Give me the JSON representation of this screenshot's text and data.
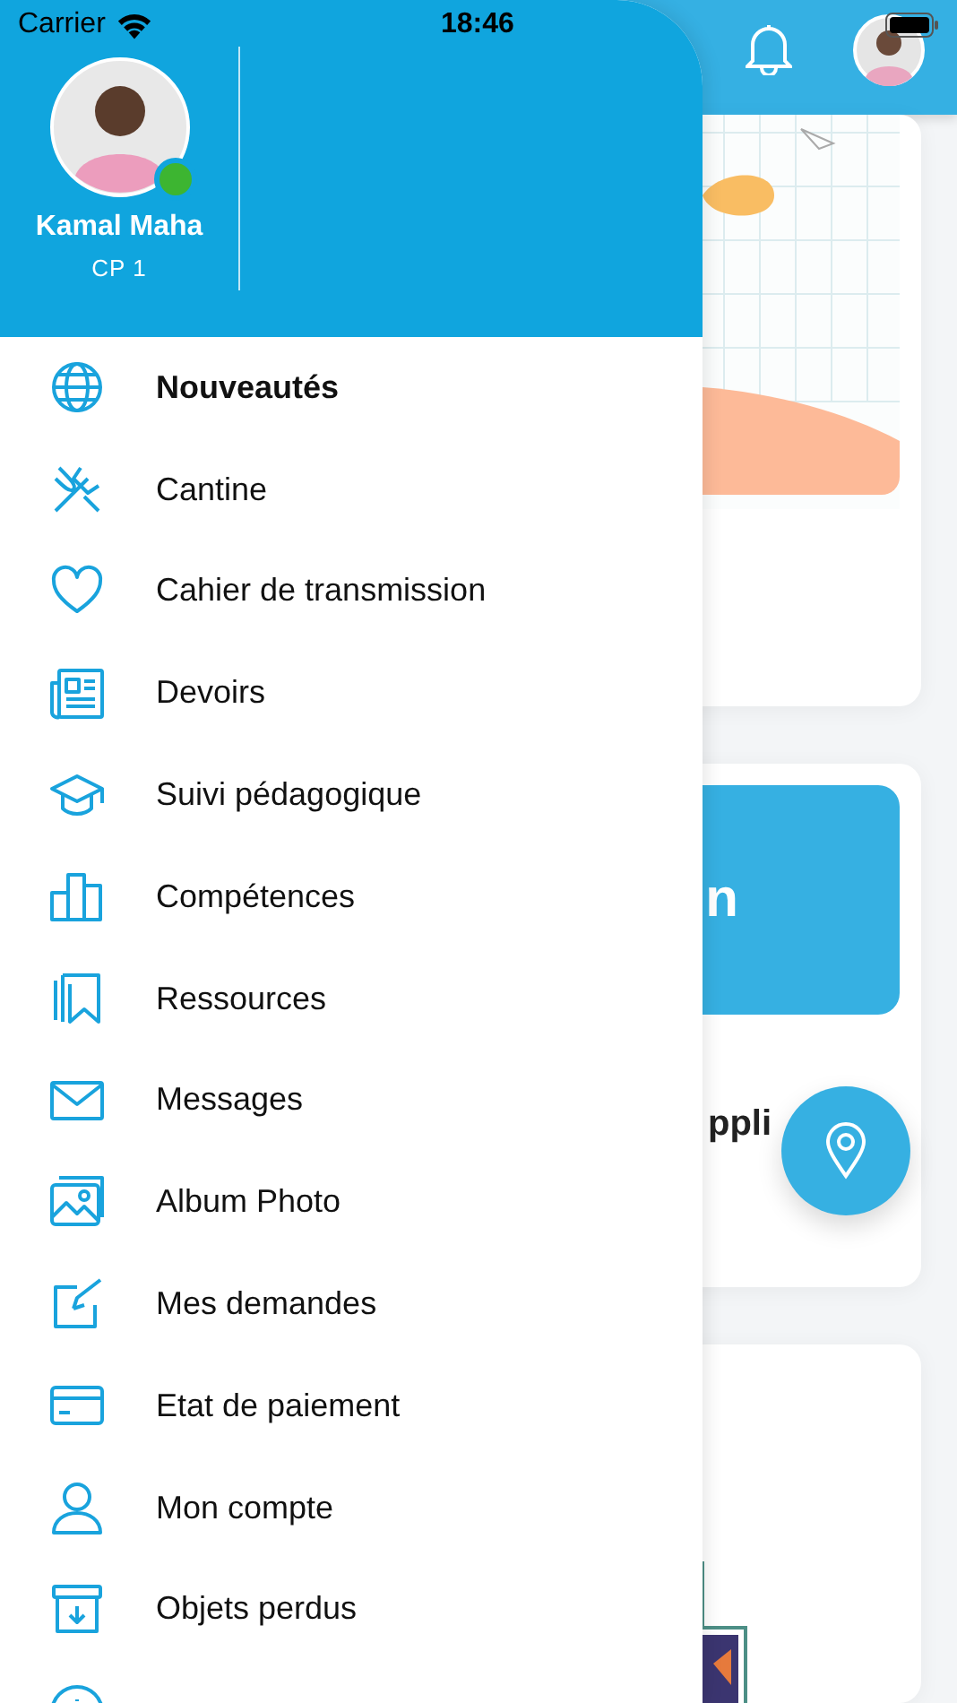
{
  "status_bar": {
    "carrier": "Carrier",
    "time": "18:46"
  },
  "profile": {
    "name": "Kamal Maha",
    "class": "CP 1",
    "online": true
  },
  "menu": [
    {
      "label": "Nouveautés",
      "selected": true
    },
    {
      "label": "Cantine",
      "selected": false
    },
    {
      "label": "Cahier de transmission",
      "selected": false
    },
    {
      "label": "Devoirs",
      "selected": false
    },
    {
      "label": "Suivi pédagogique",
      "selected": false
    },
    {
      "label": "Compétences",
      "selected": false
    },
    {
      "label": "Ressources",
      "selected": false
    },
    {
      "label": "Messages",
      "selected": false
    },
    {
      "label": "Album Photo",
      "selected": false
    },
    {
      "label": "Mes demandes",
      "selected": false
    },
    {
      "label": "Etat de paiement",
      "selected": false
    },
    {
      "label": "Mon compte",
      "selected": false
    },
    {
      "label": "Objets perdus",
      "selected": false
    }
  ],
  "background": {
    "banner_text": "n",
    "card_text": "ppli"
  }
}
